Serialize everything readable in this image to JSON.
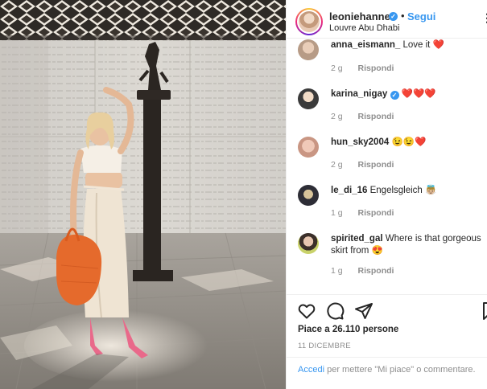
{
  "post": {
    "username": "leoniehanne",
    "follow_label": "Segui",
    "separator": "•",
    "location": "Louvre Abu Dhabi",
    "more_label": "⋮"
  },
  "comments": [
    {
      "username": "anna_eismann_",
      "text": "Love it ❤️",
      "time": "2 g",
      "reply": "Rispondi",
      "verified": false
    },
    {
      "username": "karina_nigay",
      "text": "❤️❤️❤️",
      "time": "2 g",
      "reply": "Rispondi",
      "verified": true
    },
    {
      "username": "hun_sky2004",
      "text": "😉😉❤️",
      "time": "2 g",
      "reply": "Rispondi",
      "verified": false
    },
    {
      "username": "le_di_16",
      "text": "Engelsgleich 👼🏼",
      "time": "1 g",
      "reply": "Rispondi",
      "verified": false
    },
    {
      "username": "spirited_gal",
      "text": "Where is that gorgeous skirt from 😍",
      "time": "1 g",
      "reply": "Rispondi",
      "verified": false
    }
  ],
  "actions": {
    "likes": "Piace a 26.110 persone",
    "date": "11 DICEMBRE"
  },
  "add_comment": {
    "login_link": "Accedi",
    "prompt": "per mettere \"Mi piace\" o commentare."
  },
  "icons": {
    "like": "heart-icon",
    "comment": "comment-icon",
    "share": "share-icon",
    "save": "bookmark-icon",
    "verified": "verified-badge-icon"
  },
  "colors": {
    "accent": "#3897f0",
    "heart": "#ed4956",
    "muted": "#8e8e8e",
    "text": "#262626"
  }
}
